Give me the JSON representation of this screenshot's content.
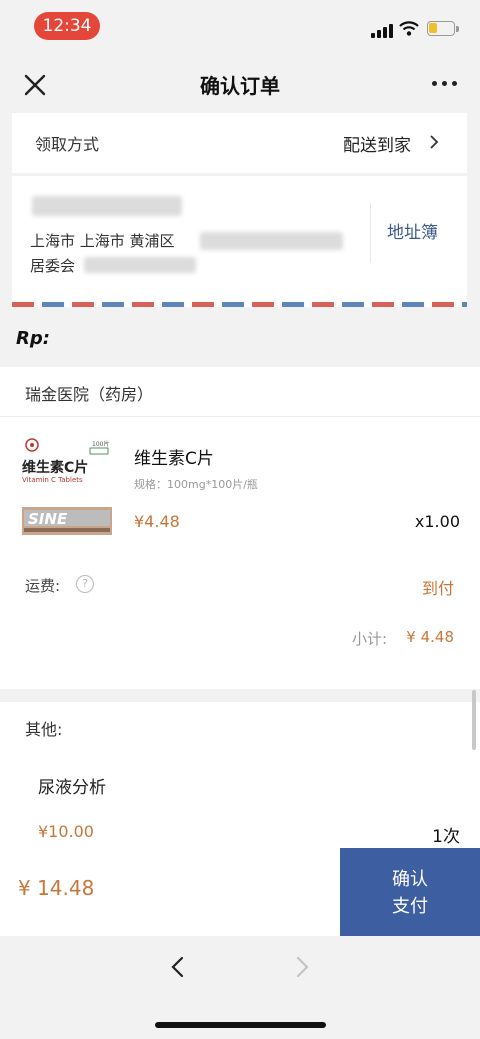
{
  "status_bar": {
    "time": "12:34",
    "battery_color": "#f0c02c",
    "time_pill_color": "#e4473a"
  },
  "nav": {
    "title": "确认订单",
    "close_icon": "close-icon",
    "more_icon": "more-icon"
  },
  "pickup": {
    "label": "领取方式",
    "value": "配送到家"
  },
  "address": {
    "line1": "上海市 上海市 黄浦区",
    "line2": "居委会",
    "book_label": "地址簿"
  },
  "prescription": {
    "label": "Rp:"
  },
  "pharmacy": {
    "name": "瑞金医院（药房）",
    "product": {
      "name": "维生素C片",
      "spec": "规格：100mg*100片/瓶",
      "price": "¥4.48",
      "quantity": "x1.00",
      "logo_text": "维生素C片",
      "logo_subtext": "Vitamin C Tablets",
      "logo_badge": "100片",
      "stamp_text": "SINE"
    },
    "shipping_label": "运费:",
    "shipping_value": "到付",
    "subtotal_label": "小计:",
    "subtotal_value": "¥ 4.48"
  },
  "other": {
    "label": "其他:",
    "service_name": "尿液分析",
    "service_price": "¥10.00",
    "service_count": "1次"
  },
  "footer": {
    "total": "¥ 14.48",
    "confirm_line1": "确认",
    "confirm_line2": "支付",
    "accent_color": "#3d5ea0",
    "price_color": "#c8773a"
  }
}
